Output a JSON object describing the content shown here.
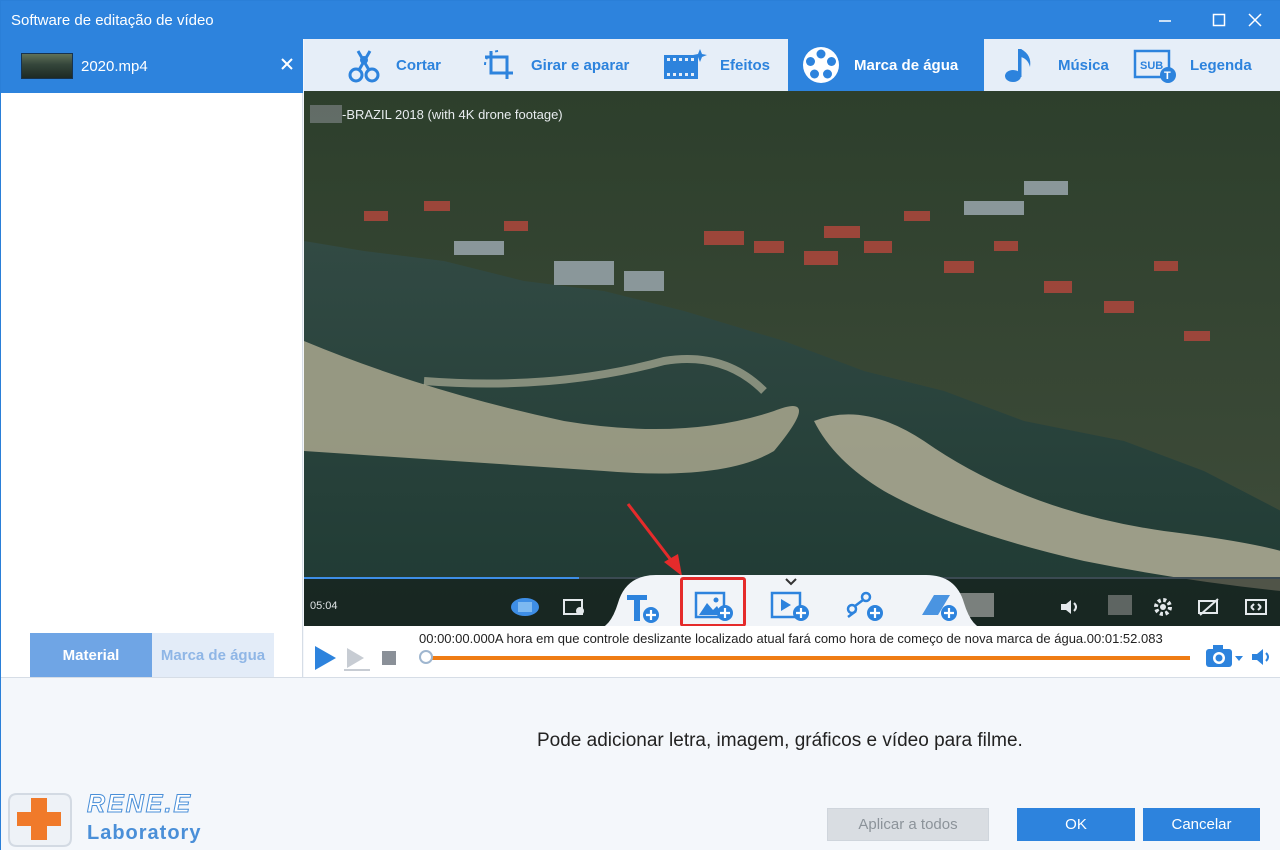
{
  "window": {
    "title": "Software de editação de vídeo"
  },
  "file_panel": {
    "file_name": "2020.mp4",
    "tabs": [
      "Material",
      "Marca de água"
    ],
    "active_tab": "Material"
  },
  "toolbar": {
    "tabs": [
      {
        "label": "Cortar",
        "icon": "scissors-icon"
      },
      {
        "label": "Girar e aparar",
        "icon": "crop-rotate-icon"
      },
      {
        "label": "Efeitos",
        "icon": "effects-film-icon"
      },
      {
        "label": "Marca de água",
        "icon": "watermark-film-reel-icon",
        "active": true
      },
      {
        "label": "Música",
        "icon": "music-note-icon"
      },
      {
        "label": "Legenda",
        "icon": "subtitle-icon"
      }
    ]
  },
  "video": {
    "overlay_title": "-BRAZIL 2018 (with 4K drone footage)",
    "duration_text": "05:04",
    "popover_tools": [
      {
        "name": "add-text-watermark-icon"
      },
      {
        "name": "add-image-watermark-icon",
        "highlighted": true
      },
      {
        "name": "add-video-watermark-icon"
      },
      {
        "name": "add-graphic-watermark-icon"
      },
      {
        "name": "add-shape-watermark-icon"
      }
    ]
  },
  "player": {
    "start_time": "00:00:00.000",
    "help_text": "A hora em que controle deslizante localizado atual fará como hora de começo de nova marca de água.",
    "end_time": "00:01:52.083",
    "progress": 0.0
  },
  "bottom": {
    "hint": "Pode adicionar letra, imagem, gráficos e vídeo para filme.",
    "apply_all_label": "Aplicar a todos",
    "ok_label": "OK",
    "cancel_label": "Cancelar"
  },
  "branding": {
    "logo_name": "RENE.E",
    "logo_sub": "Laboratory"
  },
  "colors": {
    "accent": "#2d83dd",
    "timeline": "#ef7c14",
    "highlight_box": "#e52b2b"
  }
}
